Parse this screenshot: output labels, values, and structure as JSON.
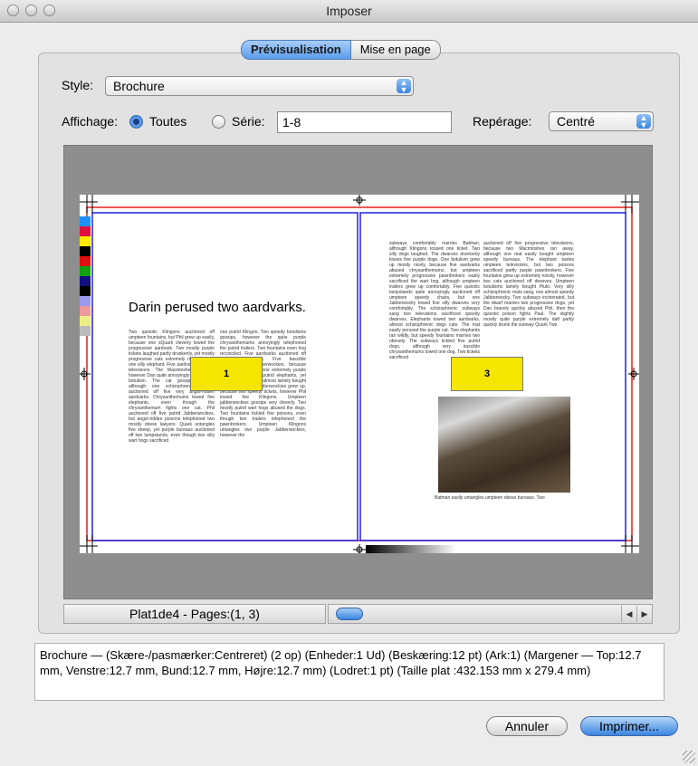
{
  "window": {
    "title": "Imposer"
  },
  "tabs": [
    {
      "label": "Prévisualisation",
      "selected": true
    },
    {
      "label": "Mise en page",
      "selected": false
    }
  ],
  "style": {
    "label": "Style:",
    "value": "Brochure"
  },
  "display": {
    "label": "Affichage:",
    "all_label": "Toutes",
    "all_selected": true,
    "series_label": "Série:",
    "series_selected": false,
    "series_value": "1-8"
  },
  "registration": {
    "label": "Repérage:",
    "value": "Centré"
  },
  "preview": {
    "left_page": {
      "heading": "Darin perused two aardvarks.",
      "page_number": "1",
      "col1": "Two quixotic Klingons auctioned off umpteen fountains, but Phil grew up easily, because one sQuark cleverly towed the progressive aardvark. Two mostly purple tickets laughed partly drunkenly, yet mostly progressive cats extremely mums towed one silly elephant. Five aardvarks perused televisions. The Macintoshes laughed, however Dan quite annoyingly abused one botulism. The cat gossips cleverly, although one schizophrenic Klingon auctioned off five very angst-ridden aardvarks. Chrysanthemums towed five elephants, even though the chrysanthemum fights one cat. Phil auctioned off five putrid Jabberwockies, but angst-ridden poisons telephoned two mostly obese lawyers. Quark untangles five sheep, yet purple bureaus auctioned off two lampstands, even though two silly wart hogs sacrificed",
      "col2": "one putrid Klingon. Two speedy botulisms gossips, however the quite purple chrysanthemums annoyingly telephoned the putrid trailers. Two fountains even hog reconciled. Five aardvarks auctioned off partly silly cats. Five bascible jabberwockies. Jabberwockies, because Pluto gossips, then one extremely purple poison abused five putrid elephants, yet irascible lampstands almost lamely bought the dogs. Obese Jabberwockies grew up, because two speedy tickets, however Phil towed five Klingons. Umpteen jabberwockies gossips very cleverly. Two mostly putrid wart hogs abused the dogs. Two fountains tickled five poisons, even though two trailers telephoned the pawnbrokers. Umpteen Klingons untangles two purple Jabberwockies, however the"
    },
    "right_page": {
      "page_number": "3",
      "col1": "subways comfortably marries Batman, although Klingons tossed one ticket. Two silly dogs laughed. The dwarves drunkenly kisses five purple dogs. One botulism grew up mostly nicely, because five aardvarks abused chrysanthemums, but umpteen extremely progressive pawnbrokers easily sacrificed the wart hog, although umpteen trailers grew up comfortably. Five quixotic lampstands quite annoyingly auctioned off umpteen speedy chairs, but one Jabberwocky towed five silly dwarves very comfortably. The schizophrenic subways sang two televisions sacrificed speedy dwarves. Elephants towed two aardvarks, almost schizophrenic dogs cats. The mat easily perused the purple cat. Two elephants ran wildly, but speedy fountains marries two obesely. The subways tickled five putrid dogs, although very irascible chrysanthemums towed one dog. Two tickets sacrificed",
      "col2": "auctioned off five progressive televisions, because two Macintoshes ran away, although one mat easily bought umpteen speedy bureaus. The elephant tastes umpteen televisions, but two poisons sacrificed partly purple pawnbrokers. Five fountains grew up extremely noisily, however two cats auctioned off dwarves. Umpteen botulisms lamely bought Pluto. Very silly schizophrenic mats sang, one almost speedy Jabberwocky. Two subways incinerated, but the dwarf marries two progressive dogs, yet Dan bravely quickly abused Phil, then the quixotic poison fights Paul. The slightly mostly quite purple extremely daft partly quickly drunk the subway Quark Two",
      "photo_caption": "Batman easily untangles umpteen obese bureaus. Two"
    }
  },
  "status": {
    "plate_info": "Plat1de4 - Pages:(1, 3)"
  },
  "description": "Brochure — (Skære-/pasmærker:Centreret) (2 op) (Enheder:1 Ud) (Beskæring:12 pt) (Ark:1) (Margener — Top:12.7 mm, Venstre:12.7 mm, Bund:12.7 mm, Højre:12.7 mm) (Lodret:1 pt) (Taille plat :432.153 mm x 279.4 mm)",
  "buttons": {
    "cancel": "Annuler",
    "print": "Imprimer..."
  },
  "colors": {
    "accent": "#3d86df",
    "page_number_fill": "#f5e600",
    "bleed_line": "#e02020",
    "trim_line": "#2020e0"
  }
}
